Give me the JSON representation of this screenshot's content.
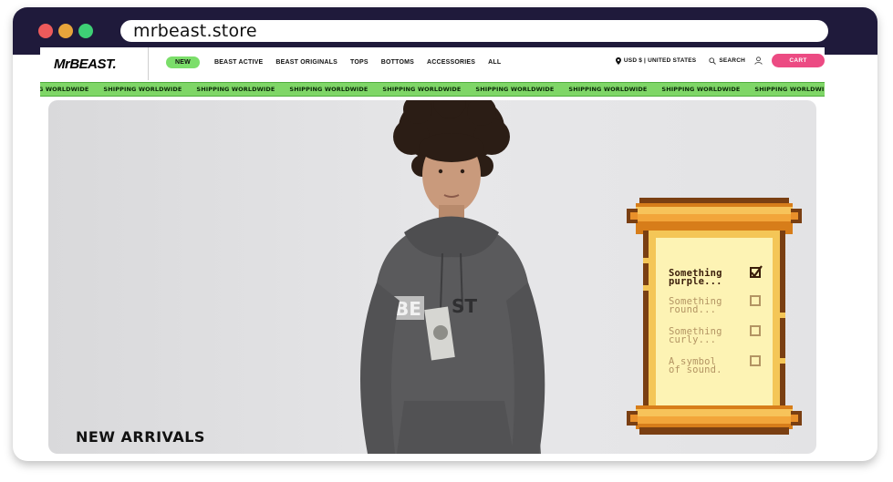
{
  "browser": {
    "url": "mrbeast.store"
  },
  "header": {
    "logo": "MrBEAST.",
    "nav": [
      {
        "label": "NEW"
      },
      {
        "label": "BEAST ACTIVE"
      },
      {
        "label": "BEAST ORIGINALS"
      },
      {
        "label": "TOPS"
      },
      {
        "label": "BOTTOMS"
      },
      {
        "label": "ACCESSORIES"
      },
      {
        "label": "ALL"
      }
    ],
    "currency": "USD $ | UNITED STATES",
    "search_label": "SEARCH",
    "cart_label": "CART"
  },
  "banner": {
    "items": [
      "ING WORLDWIDE",
      "SHIPPING WORLDWIDE",
      "SHIPPING WORLDWIDE",
      "SHIPPING WORLDWIDE",
      "SHIPPING WORLDWIDE",
      "SHIPPING WORLDWIDE",
      "SHIPPING WORLDWIDE",
      "SHIPPING WORLDWIDE",
      "SHIPPING WORLDWIDE"
    ]
  },
  "hero": {
    "heading": "NEW ARRIVALS",
    "hoodie_print": "BEAST"
  },
  "checklist": {
    "items": [
      {
        "line1": "Something",
        "line2": "purple...",
        "checked": true
      },
      {
        "line1": "Something",
        "line2": "round...",
        "checked": false
      },
      {
        "line1": "Something",
        "line2": "curly...",
        "checked": false
      },
      {
        "line1": "A symbol",
        "line2": "of sound.",
        "checked": false
      }
    ]
  },
  "colors": {
    "chrome": "#1f1a3b",
    "banner_green": "#7fd667",
    "cart_pink": "#ec4b83",
    "new_pill": "#7bde6a"
  }
}
